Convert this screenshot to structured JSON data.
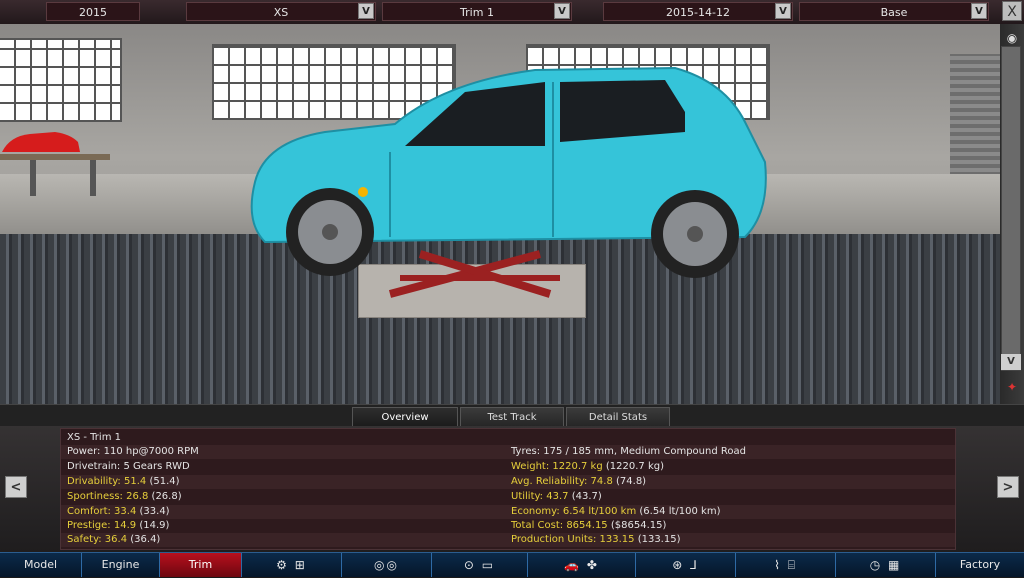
{
  "topbar": {
    "year": "2015",
    "model": "XS",
    "trim": "Trim 1",
    "date": "2015-14-12",
    "variant": "Base",
    "dropdown_glyph": "V",
    "close_glyph": "X"
  },
  "tabs": {
    "overview": "Overview",
    "test_track": "Test Track",
    "detail_stats": "Detail Stats"
  },
  "stats": {
    "title": "XS - Trim 1",
    "power": "Power: 110 hp@7000 RPM",
    "drivetrain": "Drivetrain: 5 Gears RWD",
    "drivability": "Drivability: 51.4",
    "drivability_prev": "(51.4)",
    "sportiness": "Sportiness: 26.8",
    "sportiness_prev": "(26.8)",
    "comfort": "Comfort: 33.4",
    "comfort_prev": "(33.4)",
    "prestige": "Prestige: 14.9",
    "prestige_prev": "(14.9)",
    "safety": "Safety: 36.4",
    "safety_prev": "(36.4)",
    "tyres": "Tyres: 175 / 185 mm, Medium Compound Road",
    "weight": "Weight: 1220.7 kg",
    "weight_prev": "(1220.7 kg)",
    "reliability": "Avg. Reliability: 74.8",
    "reliability_prev": "(74.8)",
    "utility": "Utility: 43.7",
    "utility_prev": "(43.7)",
    "economy": "Economy: 6.54 lt/100 km",
    "economy_prev": "(6.54 lt/100 km)",
    "cost": "Total Cost: 8654.15",
    "cost_prev": "($8654.15)",
    "production": "Production Units: 133.15",
    "production_prev": "(133.15)"
  },
  "nav": {
    "prev": "<",
    "next": ">"
  },
  "bottomnav": {
    "model": "Model",
    "engine": "Engine",
    "trim": "Trim",
    "factory": "Factory"
  },
  "colors": {
    "car": "#35c4d9",
    "accent_red": "#b7101d",
    "stat_highlight": "#e6cf3b"
  }
}
